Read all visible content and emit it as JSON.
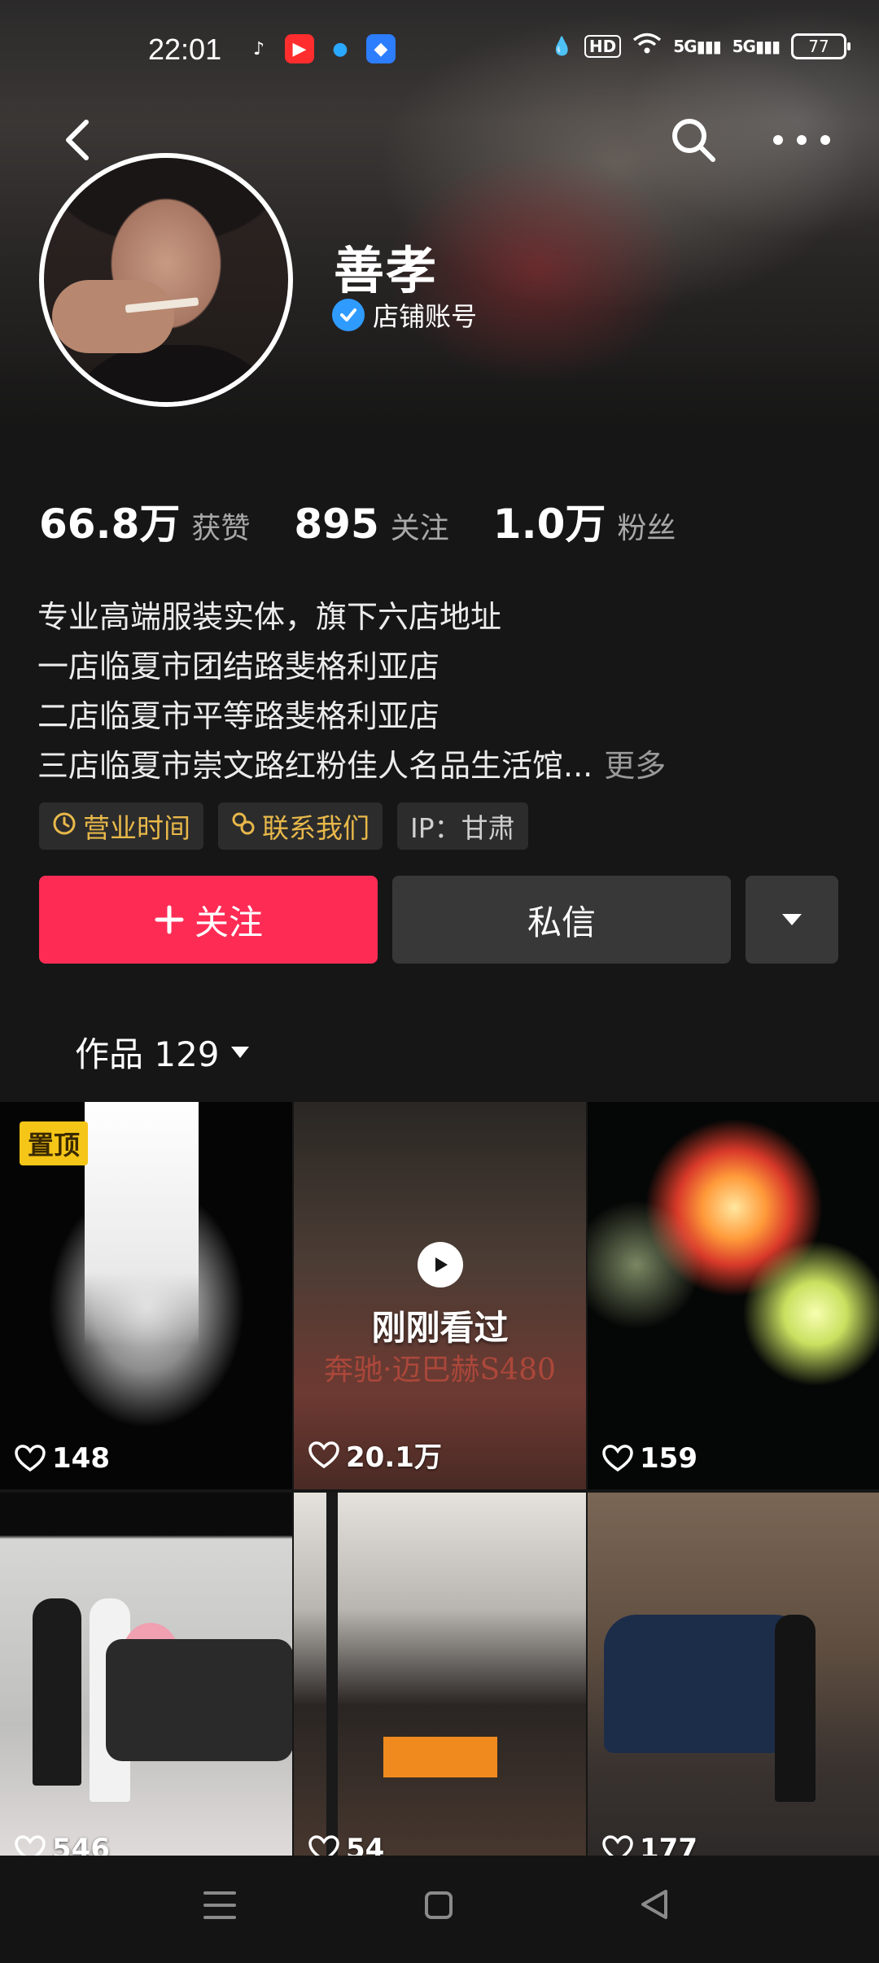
{
  "status": {
    "time": "22:01",
    "hd": "HD",
    "signal1": "5G",
    "signal2": "5G",
    "battery": "77"
  },
  "profile": {
    "name": "善孝",
    "account_type": "店铺账号"
  },
  "stats": [
    {
      "value": "66.8万",
      "label": "获赞"
    },
    {
      "value": "895",
      "label": "关注"
    },
    {
      "value": "1.0万",
      "label": "粉丝"
    }
  ],
  "bio": {
    "line1": "专业高端服装实体，旗下六店地址",
    "line2": "一店临夏市团结路斐格利亚店",
    "line3": "二店临夏市平等路斐格利亚店",
    "line4": "三店临夏市崇文路红粉佳人名品生活馆...",
    "more": "更多"
  },
  "chips": {
    "hours": "营业时间",
    "contact": "联系我们",
    "ip": "IP：甘肃"
  },
  "actions": {
    "follow": "关注",
    "message": "私信"
  },
  "works": {
    "label": "作品 129"
  },
  "videos": [
    {
      "likes": "148",
      "pinned": "置顶"
    },
    {
      "likes": "20.1万",
      "overlay": "刚刚看过",
      "frame_text": "奔驰·迈巴赫S480"
    },
    {
      "likes": "159"
    },
    {
      "likes": "546"
    },
    {
      "likes": "54"
    },
    {
      "likes": "177"
    }
  ],
  "colors": {
    "follow_button": "#fe2c55",
    "chip_gold": "#e8b84a",
    "pin_badge": "#f5c518",
    "verify_badge": "#2f9bff"
  }
}
